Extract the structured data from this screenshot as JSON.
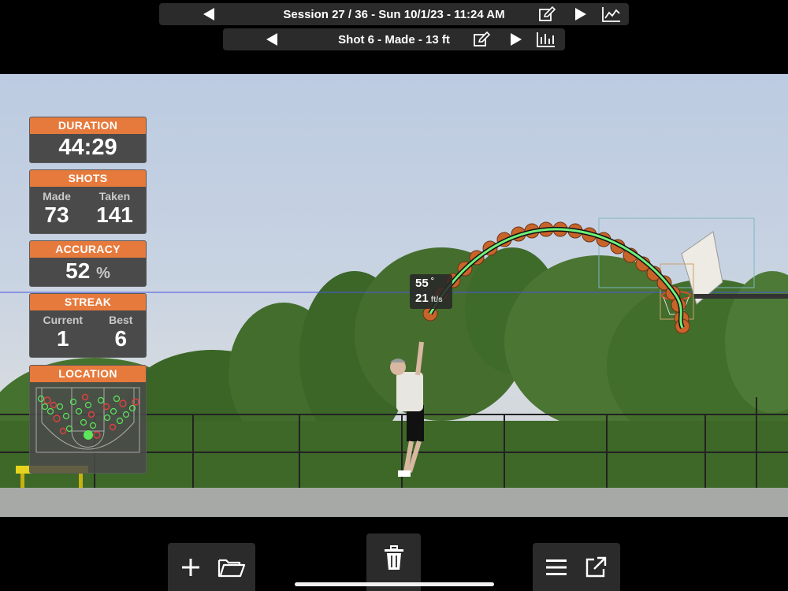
{
  "session_bar": {
    "title": "Session 27 / 36 - Sun 10/1/23 - 11:24 AM",
    "icons": [
      "prev-arrow",
      "edit-icon",
      "next-arrow",
      "line-chart-icon"
    ]
  },
  "shot_bar": {
    "title": "Shot 6 - Made - 13 ft",
    "icons": [
      "prev-arrow",
      "edit-icon",
      "next-arrow",
      "bar-chart-icon"
    ]
  },
  "stats": {
    "duration": {
      "label": "DURATION",
      "value": "44:29"
    },
    "shots": {
      "label": "SHOTS",
      "made_label": "Made",
      "made": "73",
      "taken_label": "Taken",
      "taken": "141"
    },
    "accuracy": {
      "label": "ACCURACY",
      "value": "52",
      "unit": "%"
    },
    "streak": {
      "label": "STREAK",
      "current_label": "Current",
      "current": "1",
      "best_label": "Best",
      "best": "6"
    },
    "location": {
      "label": "LOCATION"
    }
  },
  "trajectory": {
    "angle": "55",
    "angle_unit": "°",
    "speed": "21",
    "speed_unit": "ft/s"
  },
  "colors": {
    "accent": "#e67a3c",
    "panel": "#4a4a4a",
    "bar": "#2b2b2b",
    "made": "#5ce65c",
    "missed": "#e04040"
  },
  "toolbar": {
    "left": [
      "add-icon",
      "folder-icon"
    ],
    "center": [
      "trash-icon"
    ],
    "right": [
      "menu-icon",
      "share-icon"
    ]
  }
}
